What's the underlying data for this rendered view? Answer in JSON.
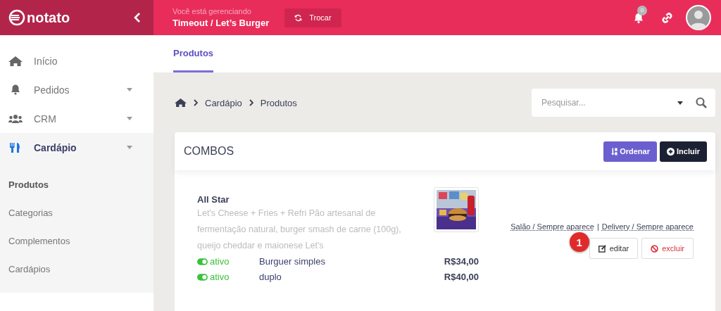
{
  "brand": {
    "name": "notato"
  },
  "header": {
    "context_label": "Você está gerenciando",
    "context_value": "Timeout / Let’s Burger",
    "switch_button": "Trocar",
    "notification_count": "0"
  },
  "sidebar": {
    "items": [
      {
        "label": "Início",
        "expandable": false,
        "selected": false
      },
      {
        "label": "Pedidos",
        "expandable": true,
        "selected": false
      },
      {
        "label": "CRM",
        "expandable": true,
        "selected": false
      },
      {
        "label": "Cardápio",
        "expandable": true,
        "selected": true
      }
    ],
    "subitems": [
      {
        "label": "Produtos",
        "selected": true
      },
      {
        "label": "Categorias",
        "selected": false
      },
      {
        "label": "Complementos",
        "selected": false
      },
      {
        "label": "Cardápios",
        "selected": false
      }
    ]
  },
  "tabs": [
    {
      "label": "Produtos",
      "selected": true
    }
  ],
  "breadcrumb": [
    "Cardápio",
    "Produtos"
  ],
  "search": {
    "placeholder": "Pesquisar..."
  },
  "section": {
    "title": "COMBOS",
    "buttons": [
      {
        "label": "Ordenar",
        "kind": "sort"
      },
      {
        "label": "Incluir",
        "kind": "add"
      }
    ]
  },
  "products": [
    {
      "name": "All Star",
      "description": "Let's Cheese + Fries + Refri Pão artesanal de fermentação natural, burger smash de carne (100g), queijo cheddar e maionese Let's",
      "availability": [
        "Salão / Sempre aparece",
        "Delivery / Sempre aparece"
      ],
      "availability_separator": "|",
      "variants": [
        {
          "status": "ativo",
          "on": true,
          "name": "Burguer simples",
          "price": "R$34,00"
        },
        {
          "status": "ativo",
          "on": true,
          "name": "duplo",
          "price": "R$40,00"
        }
      ],
      "actions": [
        {
          "label": "editar",
          "kind": "edit"
        },
        {
          "label": "excluir",
          "kind": "delete"
        }
      ],
      "callout": "1"
    }
  ]
}
